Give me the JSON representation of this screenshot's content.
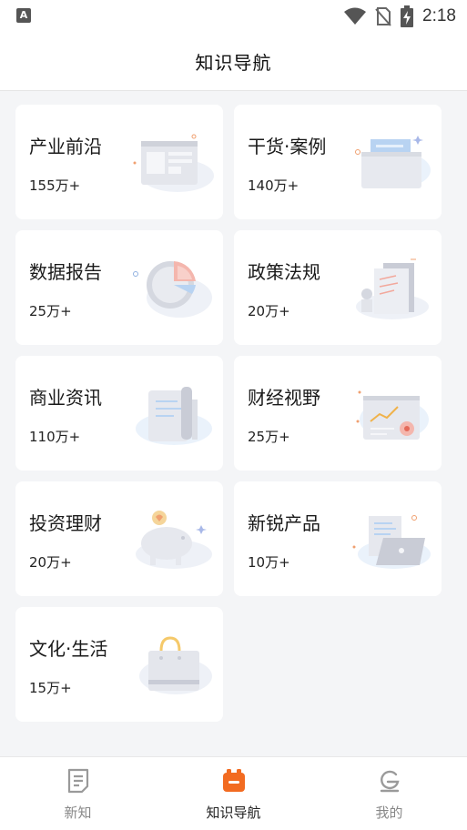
{
  "status_bar": {
    "left_badge": "A",
    "time": "2:18",
    "icons": [
      "wifi-icon",
      "no-sim-icon",
      "battery-charging-icon"
    ]
  },
  "header": {
    "title": "知识导航"
  },
  "categories": [
    {
      "title": "产业前沿",
      "count": "155万+",
      "icon": "newspaper-illustration"
    },
    {
      "title": "干货·案例",
      "count": "140万+",
      "icon": "folder-illustration"
    },
    {
      "title": "数据报告",
      "count": "25万+",
      "icon": "pie-chart-illustration"
    },
    {
      "title": "政策法规",
      "count": "20万+",
      "icon": "law-book-illustration"
    },
    {
      "title": "商业资讯",
      "count": "110万+",
      "icon": "document-scroll-illustration"
    },
    {
      "title": "财经视野",
      "count": "25万+",
      "icon": "trend-chart-illustration"
    },
    {
      "title": "投资理财",
      "count": "20万+",
      "icon": "piggy-bank-illustration"
    },
    {
      "title": "新锐产品",
      "count": "10万+",
      "icon": "laptop-illustration"
    },
    {
      "title": "文化·生活",
      "count": "15万+",
      "icon": "shopping-bag-illustration"
    }
  ],
  "bottom_nav": {
    "items": [
      {
        "label": "新知",
        "icon": "news-icon",
        "active": false
      },
      {
        "label": "知识导航",
        "icon": "navigation-icon",
        "active": true
      },
      {
        "label": "我的",
        "icon": "profile-icon",
        "active": false
      }
    ]
  },
  "colors": {
    "accent": "#f26b21",
    "background": "#f4f5f7",
    "card": "#ffffff",
    "illustration_gray": "#dfe1e8",
    "illustration_blue": "#b8d3f2"
  }
}
